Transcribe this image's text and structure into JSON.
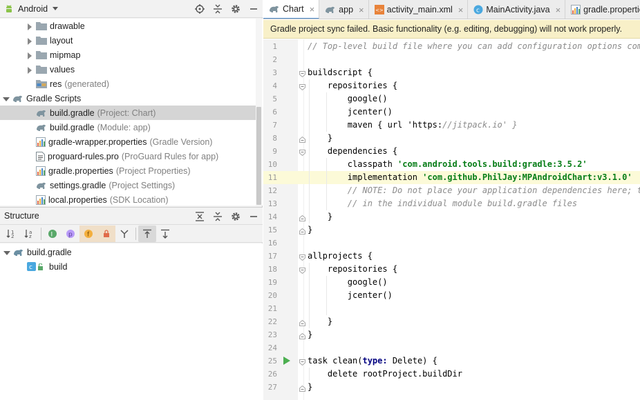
{
  "colors": {
    "accent": "#4a88c7",
    "selection": "#d5d5d5",
    "banner_bg": "#f8f0c8",
    "line_highlight": "#fcfad8",
    "string": "#067d17",
    "comment": "#8c8c8c",
    "run_green": "#4caf50"
  },
  "project_panel": {
    "view": "Android",
    "tree": [
      {
        "label": "drawable",
        "sub": "",
        "icon": "folder-icon",
        "expanded": false
      },
      {
        "label": "layout",
        "sub": "",
        "icon": "folder-icon",
        "expanded": false
      },
      {
        "label": "mipmap",
        "sub": "",
        "icon": "folder-icon",
        "expanded": false
      },
      {
        "label": "values",
        "sub": "",
        "icon": "folder-icon",
        "expanded": false
      },
      {
        "label": "res",
        "sub": "(generated)",
        "icon": "res-folder-icon"
      },
      {
        "label": "Gradle Scripts",
        "sub": "",
        "icon": "gradle-icon",
        "expanded": true
      },
      {
        "label": "build.gradle",
        "sub": "(Project: Chart)",
        "icon": "gradle-icon",
        "selected": true
      },
      {
        "label": "build.gradle",
        "sub": "(Module: app)",
        "icon": "gradle-icon"
      },
      {
        "label": "gradle-wrapper.properties",
        "sub": "(Gradle Version)",
        "icon": "properties-icon"
      },
      {
        "label": "proguard-rules.pro",
        "sub": "(ProGuard Rules for app)",
        "icon": "text-file-icon"
      },
      {
        "label": "gradle.properties",
        "sub": "(Project Properties)",
        "icon": "properties-icon"
      },
      {
        "label": "settings.gradle",
        "sub": "(Project Settings)",
        "icon": "gradle-icon"
      },
      {
        "label": "local.properties",
        "sub": "(SDK Location)",
        "icon": "properties-icon"
      }
    ]
  },
  "structure_panel": {
    "title": "Structure",
    "tree": [
      {
        "label": "build.gradle"
      },
      {
        "label": "build"
      }
    ]
  },
  "editor": {
    "tabs": [
      {
        "label": "Chart",
        "icon": "gradle-icon",
        "active": true
      },
      {
        "label": "app",
        "icon": "gradle-icon"
      },
      {
        "label": "activity_main.xml",
        "icon": "xml-layout-icon"
      },
      {
        "label": "MainActivity.java",
        "icon": "java-class-icon"
      },
      {
        "label": "gradle.properties",
        "icon": "properties-icon"
      }
    ],
    "banner": "Gradle project sync failed. Basic functionality (e.g. editing, debugging) will not work properly.",
    "lines": [
      {
        "n": "1",
        "text": "// Top-level build file where you can add configuration options common to all sub-projects/modules."
      },
      {
        "n": "2",
        "text": ""
      },
      {
        "n": "3",
        "text": "buildscript {"
      },
      {
        "n": "4",
        "text": "    repositories {"
      },
      {
        "n": "5",
        "text": "        google()"
      },
      {
        "n": "6",
        "text": "        jcenter()"
      },
      {
        "n": "7",
        "text": "        maven { url 'https://jitpack.io' }"
      },
      {
        "n": "8",
        "text": "    }"
      },
      {
        "n": "9",
        "text": "    dependencies {"
      },
      {
        "n": "10",
        "text": "        classpath 'com.android.tools.build:gradle:3.5.2'"
      },
      {
        "n": "11",
        "text": "        implementation 'com.github.PhilJay:MPAndroidChart:v3.1.0'"
      },
      {
        "n": "12",
        "text": "        // NOTE: Do not place your application dependencies here; they belong"
      },
      {
        "n": "13",
        "text": "        // in the individual module build.gradle files"
      },
      {
        "n": "14",
        "text": "    }"
      },
      {
        "n": "15",
        "text": "}"
      },
      {
        "n": "16",
        "text": ""
      },
      {
        "n": "17",
        "text": "allprojects {"
      },
      {
        "n": "18",
        "text": "    repositories {"
      },
      {
        "n": "19",
        "text": "        google()"
      },
      {
        "n": "20",
        "text": "        jcenter()"
      },
      {
        "n": "21",
        "text": ""
      },
      {
        "n": "22",
        "text": "    }"
      },
      {
        "n": "23",
        "text": "}"
      },
      {
        "n": "24",
        "text": ""
      },
      {
        "n": "25",
        "text": "task clean(type: Delete) {"
      },
      {
        "n": "26",
        "text": "    delete rootProject.buildDir"
      },
      {
        "n": "27",
        "text": "}"
      }
    ]
  }
}
